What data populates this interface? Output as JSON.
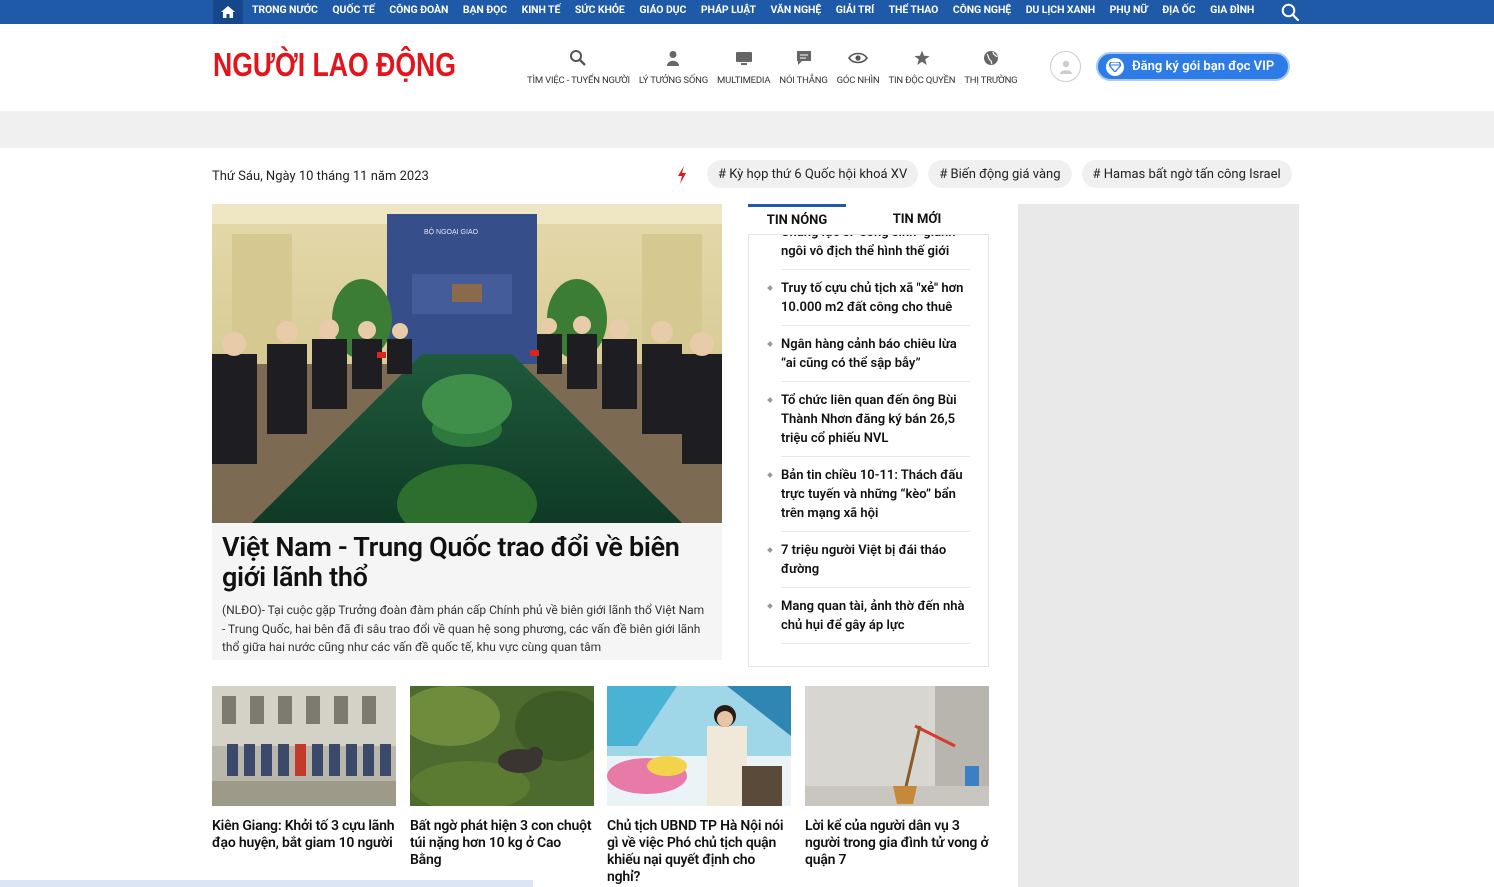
{
  "topnav": {
    "items": [
      "TRONG NƯỚC",
      "QUỐC TẾ",
      "CÔNG ĐOÀN",
      "BẠN ĐỌC",
      "KINH TẾ",
      "SỨC KHỎE",
      "GIÁO DỤC",
      "PHÁP LUẬT",
      "VĂN NGHỆ",
      "GIẢI TRÍ",
      "THỂ THAO",
      "CÔNG NGHỆ",
      "DU LỊCH XANH",
      "PHỤ NỮ",
      "ĐỊA ỐC",
      "GIA ĐÌNH"
    ],
    "home_icon": "home-icon",
    "search_icon": "search-icon",
    "bg_color": "#1e5aa8"
  },
  "header": {
    "logo_text": "NGƯỜI LAO ĐỘNG",
    "logo_color": "#e3141b",
    "categories": [
      {
        "label": "TÌM VIỆC - TUYỂN NGƯỜI",
        "icon": "search-job-icon"
      },
      {
        "label": "LÝ TƯỞNG SỐNG",
        "icon": "person-icon"
      },
      {
        "label": "MULTIMEDIA",
        "icon": "monitor-icon"
      },
      {
        "label": "NÓI THẲNG",
        "icon": "chat-icon"
      },
      {
        "label": "GÓC NHÌN",
        "icon": "eye-icon"
      },
      {
        "label": "TIN ĐỘC QUYỀN",
        "icon": "star-icon"
      },
      {
        "label": "THỊ TRƯỜNG",
        "icon": "globe-icon"
      }
    ],
    "vip_label": "Đăng ký gói bạn đọc VIP",
    "vip_color": "#2d7be6"
  },
  "trending": {
    "date": "Thứ Sáu, Ngày 10 tháng 11 năm 2023",
    "tags": [
      "# Kỳ họp thứ 6 Quốc hội khoá XV",
      "# Biến động giá vàng",
      "# Hamas bất ngờ tấn công Israel"
    ]
  },
  "featured": {
    "title": "Việt Nam - Trung Quốc trao đổi về biên giới lãnh thổ",
    "summary": "(NLĐO)- Tại cuộc gặp Trưởng đoàn đàm phán cấp Chính phủ về biên giới lãnh thổ Việt Nam - Trung Quốc, hai bên đã đi sâu trao đổi về quan hệ song phương, các vấn đề biên giới lãnh thổ giữa hai nước cũng như các vấn đề quốc tế, khu vực cùng quan tâm",
    "backdrop_text": "BỘ NGOẠI GIAO"
  },
  "hotnews": {
    "tabs": [
      "TIN NÓNG",
      "TIN MỚI"
    ],
    "items": [
      "Chàng lực sĩ \"song sinh\" giành ngôi vô địch thể hình thế giới",
      "Truy tố cựu chủ tịch xã \"xẻ\" hơn 10.000 m2 đất công cho thuê",
      "Ngân hàng cảnh báo chiêu lừa “ai cũng có thể sập bẫy”",
      "Tổ chức liên quan đến ông Bùi Thành Nhơn đăng ký bán 26,5 triệu cổ phiếu NVL",
      "Bản tin chiều 10-11: Thách đấu trực tuyến và những “kèo” bẩn trên mạng xã hội",
      "7 triệu người Việt bị đái tháo đường",
      "Mang quan tài, ảnh thờ đến nhà chủ hụi để gây áp lực"
    ]
  },
  "cards": [
    {
      "title": "Kiên Giang: Khởi tố 3 cựu lãnh đạo huyện, bắt giam 10 người"
    },
    {
      "title": "Bất ngờ phát hiện 3 con chuột túi nặng hơn 10 kg ở Cao Bằng"
    },
    {
      "title": "Chủ tịch UBND TP Hà Nội nói gì về việc Phó chủ tịch quận khiếu nại quyết định cho nghỉ?"
    },
    {
      "title": "Lời kể của người dân vụ 3 người trong gia đình tử vong ở quận 7"
    }
  ]
}
